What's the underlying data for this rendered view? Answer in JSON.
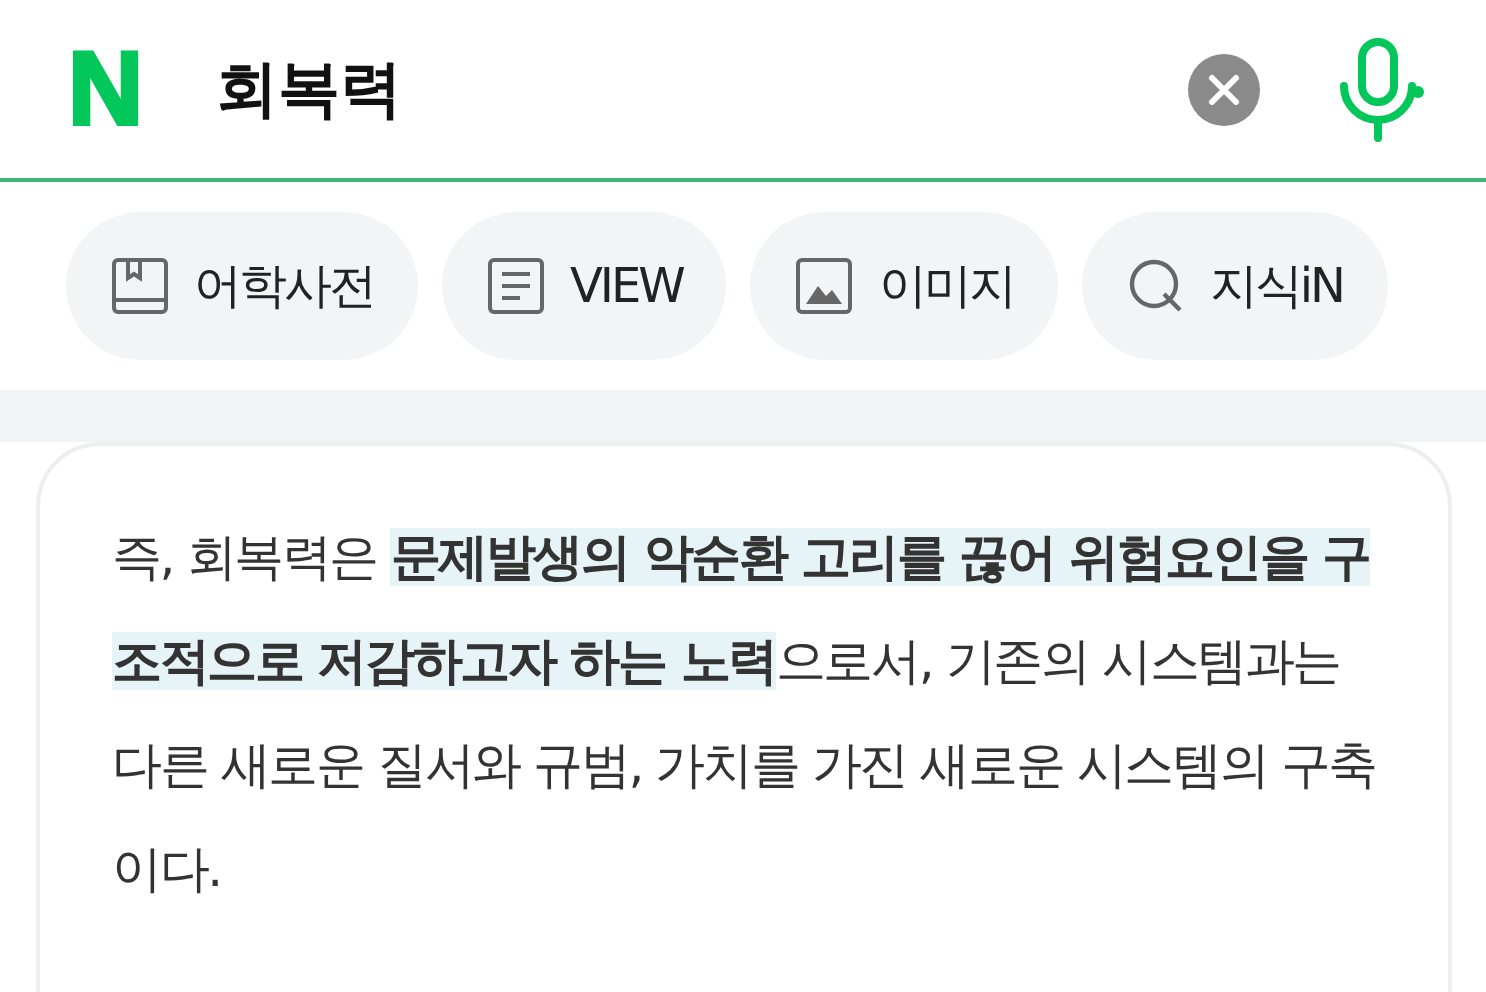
{
  "search": {
    "logo": "N",
    "query": "회복력"
  },
  "tabs": [
    {
      "label": "어학사전",
      "kind": "book"
    },
    {
      "label": "VIEW",
      "kind": "doc"
    },
    {
      "label": "이미지",
      "kind": "image"
    },
    {
      "label": "지식iN",
      "kind": "qa"
    }
  ],
  "card": {
    "text": "즉, 회복력은 **문제발생의 악순환 고리를 끊어 위험요인을 구조적으로 저감하고자 하는 노력**으로서, 기존의 시스템과는 다른 새로운 질서와 규범, 가치를 가진 새로운 시스템의 구축이다."
  }
}
